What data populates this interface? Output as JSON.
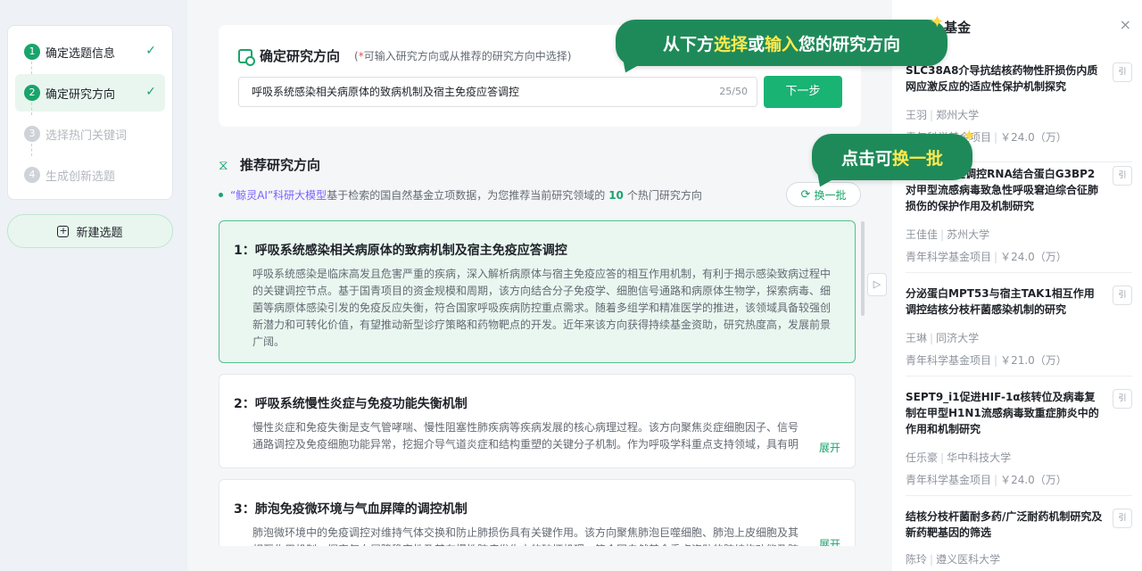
{
  "sidebar": {
    "steps": [
      {
        "num": "1",
        "label": "确定选题信息",
        "state": "done"
      },
      {
        "num": "2",
        "label": "确定研究方向",
        "state": "active"
      },
      {
        "num": "3",
        "label": "选择热门关键词",
        "state": "pending"
      },
      {
        "num": "4",
        "label": "生成创新选题",
        "state": "pending"
      }
    ],
    "check_icon": "✓",
    "new_topic_label": "新建选题"
  },
  "direction": {
    "title": "确定研究方向",
    "hint_star": "*",
    "hint_open": "(",
    "hint_text": "可输入研究方向或从推荐的研究方向中选择",
    "hint_close": ")",
    "input_value": "呼吸系统感染相关病原体的致病机制及宿主免疫应答调控",
    "char_count": "25/50",
    "next_label": "下一步"
  },
  "recommend": {
    "title": "推荐研究方向",
    "sub_model": "“鲸灵AI”科研大模型",
    "sub_text_a": "基于检索的国自然基金立项数据，为您推荐当前研究领域的",
    "sub_count": "10",
    "sub_text_b": "个热门研究方向",
    "refresh_label": "换一批",
    "more_label": "展开",
    "items": [
      {
        "title": "1：呼吸系统感染相关病原体的致病机制及宿主免疫应答调控",
        "desc": "呼吸系统感染是临床高发且危害严重的疾病，深入解析病原体与宿主免疫应答的相互作用机制，有利于揭示感染致病过程中的关键调控节点。基于国青项目的资金规模和周期，该方向结合分子免疫学、细胞信号通路和病原体生物学，探索病毒、细菌等病原体感染引发的免疫反应失衡，符合国家呼吸疾病防控重点需求。随着多组学和精准医学的推进，该领域具备较强创新潜力和可转化价值，有望推动新型诊疗策略和药物靶点的开发。近年来该方向获得持续基金资助，研究热度高，发展前景广阔。"
      },
      {
        "title": "2：呼吸系统慢性炎症与免疫功能失衡机制",
        "desc": "慢性炎症和免疫失衡是支气管哮喘、慢性阻塞性肺疾病等疾病发展的核心病理过程。该方向聚焦炎症细胞因子、信号通路调控及免疫细胞功能异常，挖掘介导气道炎症和结构重塑的关键分子机制。作为呼吸学科重点支持领域，具有明确..."
      },
      {
        "title": "3：肺泡免疫微环境与气血屏障的调控机制",
        "desc": "肺泡微环境中的免疫调控对维持气体交换和防止肺损伤具有关键作用。该方向聚焦肺泡巨噬细胞、肺泡上皮细胞及其相互作用机制，探究气血屏障稳定性及其在慢性肺病发生中的破坏机理，符合国自然基金重点资助的肺结构功能及肺损..."
      }
    ]
  },
  "tooltips": {
    "t1_a": "从下方",
    "t1_b": "选择",
    "t1_c": "或",
    "t1_d": "输入",
    "t1_e": "您的研究方向",
    "t2_a": "点击可",
    "t2_b": "换一批",
    "spark": "✦"
  },
  "right_panel": {
    "title": "基金",
    "close_icon": "×",
    "cite_label": "引",
    "items": [
      {
        "title": "SLC38A8介导抗结核药物性肝损伤内质网应激反应的适应性保护机制探究",
        "author": "王羽",
        "org": "郑州大学",
        "type": "青年科学基金项目",
        "amount": "￥24.0（万）"
      },
      {
        "title": "USPL1通过调控RNA结合蛋白G3BP2对甲型流感病毒致急性呼吸窘迫综合征肺损伤的保护作用及机制研究",
        "author": "王佳佳",
        "org": "苏州大学",
        "type": "青年科学基金项目",
        "amount": "￥24.0（万）"
      },
      {
        "title": "分泌蛋白MPT53与宿主TAK1相互作用调控结核分枝杆菌感染机制的研究",
        "author": "王琳",
        "org": "同济大学",
        "type": "青年科学基金项目",
        "amount": "￥21.0（万）"
      },
      {
        "title": "SEPT9_i1促进HIF-1α核转位及病毒复制在甲型H1N1流感病毒致重症肺炎中的作用和机制研究",
        "author": "任乐豪",
        "org": "华中科技大学",
        "type": "青年科学基金项目",
        "amount": "￥24.0（万）"
      },
      {
        "title": "结核分枝杆菌耐多药/广泛耐药机制研究及新药靶基因的筛选",
        "author": "陈玲",
        "org": "遵义医科大学",
        "type": "",
        "amount": ""
      }
    ]
  }
}
